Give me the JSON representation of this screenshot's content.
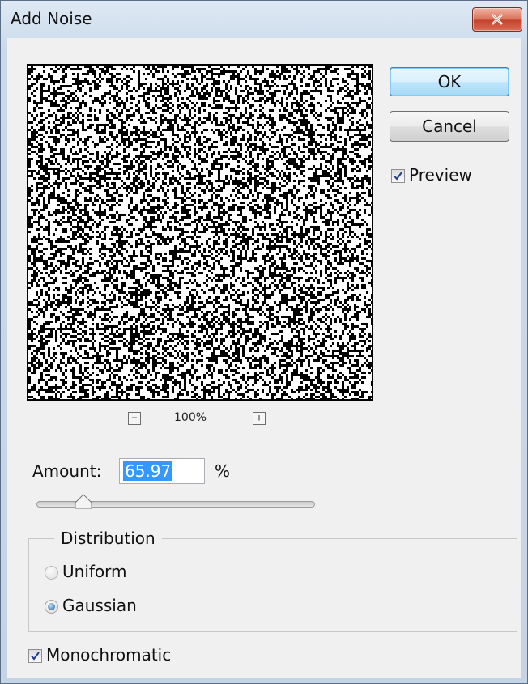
{
  "window": {
    "title": "Add Noise"
  },
  "preview": {
    "zoom_out_glyph": "−",
    "zoom_level": "100%",
    "zoom_in_glyph": "+"
  },
  "buttons": {
    "ok": "OK",
    "cancel": "Cancel"
  },
  "preview_checkbox": {
    "label": "Preview",
    "checked": true
  },
  "amount": {
    "label": "Amount:",
    "value": "65.97",
    "unit": "%",
    "slider_fraction": 0.17
  },
  "distribution": {
    "legend": "Distribution",
    "options": [
      {
        "label": "Uniform",
        "selected": false
      },
      {
        "label": "Gaussian",
        "selected": true
      }
    ]
  },
  "monochromatic": {
    "label": "Monochromatic",
    "checked": true
  },
  "icons": {
    "close": "close-icon",
    "zoom_out": "zoom-out-icon",
    "zoom_in": "zoom-in-icon",
    "checkmark": "checkmark-icon",
    "slider_thumb": "slider-thumb-icon"
  },
  "colors": {
    "selection": "#3399ff",
    "close_button": "#c6432c",
    "ok_border": "#3c7fb1"
  }
}
